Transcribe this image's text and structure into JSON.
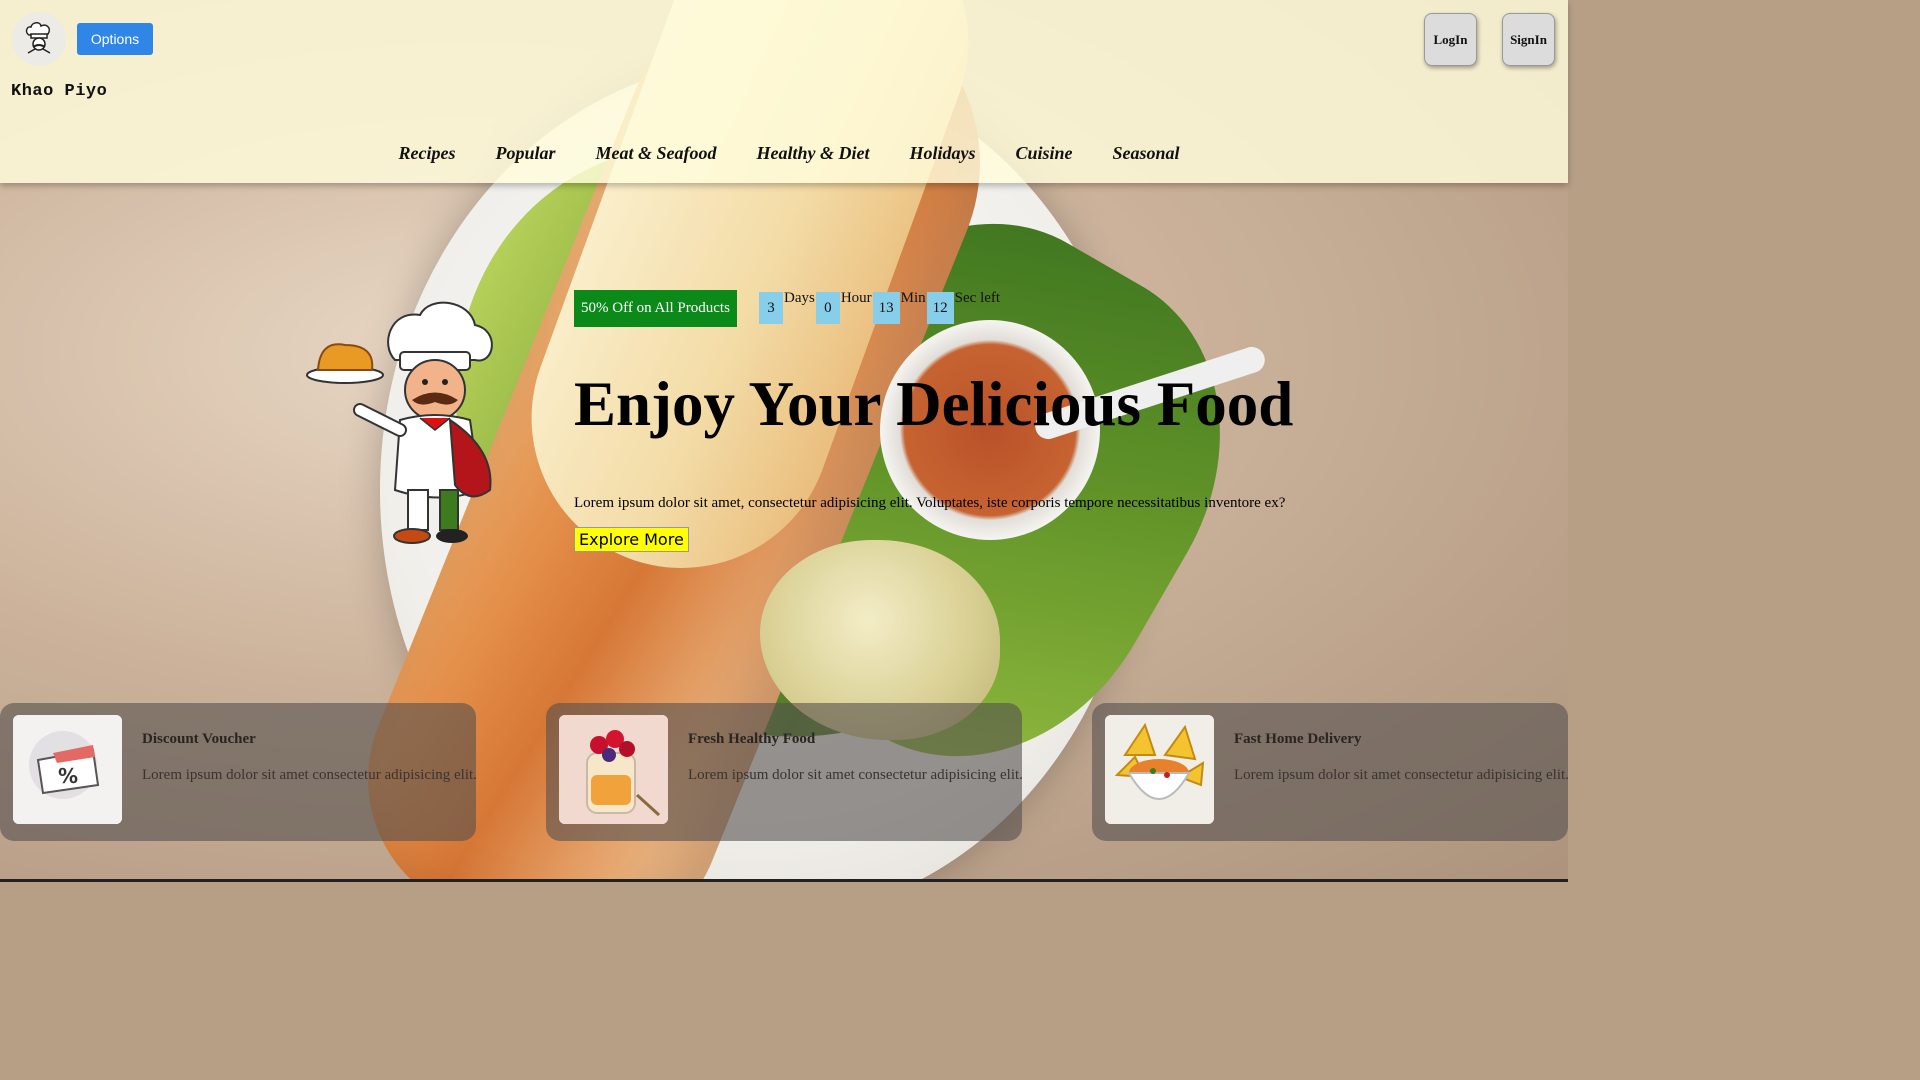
{
  "header": {
    "options_label": "Options",
    "brand": "Khao Piyo",
    "login_label": "LogIn",
    "signin_label": "SignIn",
    "nav": [
      "Recipes",
      "Popular",
      "Meat & Seafood",
      "Healthy & Diet",
      "Holidays",
      "Cuisine",
      "Seasonal"
    ]
  },
  "hero": {
    "offer": "50% Off on All Products",
    "timer": {
      "days": "3",
      "days_label": "Days",
      "hours": "0",
      "hours_label": "Hour",
      "minutes": "13",
      "minutes_label": "Min",
      "seconds": "12",
      "seconds_label": "Sec left"
    },
    "title": "Enjoy Your Delicious Food",
    "text": "Lorem ipsum dolor sit amet, consectetur adipisicing elit. Voluptates, iste corporis tempore necessitatibus inventore ex?",
    "explore_label": "Explore More"
  },
  "features": [
    {
      "title": "Discount Voucher",
      "text": "Lorem ipsum dolor sit amet consectetur adipisicing elit.",
      "icon": "discount-voucher-icon"
    },
    {
      "title": "Fresh Healthy Food",
      "text": "Lorem ipsum dolor sit amet consectetur adipisicing elit.",
      "icon": "fruit-jar-icon"
    },
    {
      "title": "Fast Home Delivery",
      "text": "Lorem ipsum dolor sit amet consectetur adipisicing elit.",
      "icon": "food-bowl-icon"
    }
  ],
  "colors": {
    "options_blue": "#2f86e6",
    "offer_green": "#0b8a1a",
    "timer_blue": "#87ceeb",
    "explore_yellow": "#ffff00"
  }
}
